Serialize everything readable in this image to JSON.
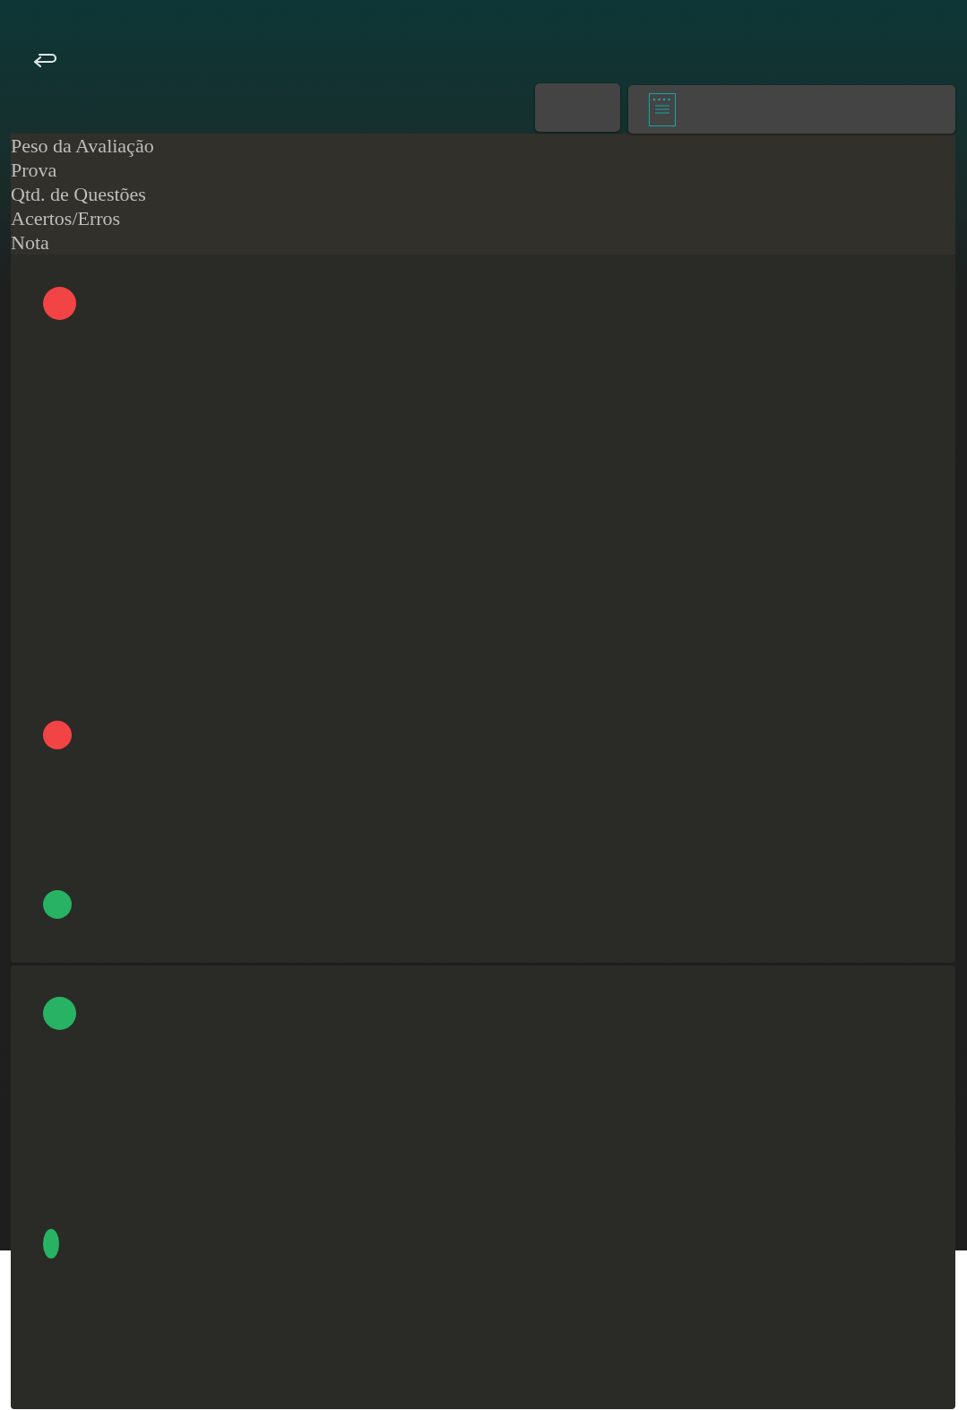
{
  "labels": [
    "Peso da Avaliação",
    "Prova",
    "Qtd. de Questões",
    "Acertos/Erros",
    "Nota"
  ],
  "cards": [
    {
      "dots": [
        {
          "color": "#f24444"
        },
        {
          "color": "#f24444"
        },
        {
          "color": "#27b363"
        }
      ]
    },
    {
      "dots": [
        {
          "color": "#27b363"
        },
        {
          "color": "#27b363"
        }
      ]
    }
  ]
}
